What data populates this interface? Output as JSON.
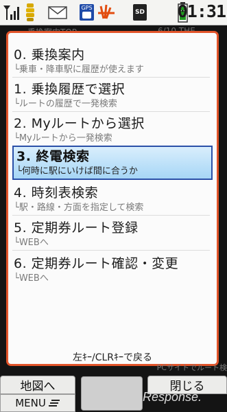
{
  "status_bar": {
    "gps_label": "GPS",
    "sd_label": "SD",
    "time": "01:31"
  },
  "background_screen": {
    "title": "乗換案内TOP",
    "date": "6/10 THE"
  },
  "menu": {
    "items": [
      {
        "title": "0. 乗換案内",
        "subtitle": "└乗車・降車駅に履歴が使えます"
      },
      {
        "title": "1. 乗換履歴で選択",
        "subtitle": "└ルートの履歴で一発検索"
      },
      {
        "title": "2. Myルートから選択",
        "subtitle": "└Myルートから一発検索"
      },
      {
        "title": "3. 終電検索",
        "subtitle": "└何時に駅にいけば間に合うか"
      },
      {
        "title": "4. 時刻表検索",
        "subtitle": "└駅・路線・方面を指定して検索"
      },
      {
        "title": "5. 定期券ルート登録",
        "subtitle": "└WEBへ"
      },
      {
        "title": "6. 定期券ルート確認・変更",
        "subtitle": "└WEBへ"
      }
    ],
    "selected_index": 3,
    "hint": "左ｷｰ/CLRｷｰで戻る"
  },
  "bottom": {
    "pc_note": "PCサイトでルート検",
    "left_key": "地図へ",
    "right_key": "閉じる",
    "menu_key": "MENU",
    "watermark": "Response."
  },
  "colors": {
    "popup_border": "#e2542a",
    "selection": "#a6d6f6"
  }
}
